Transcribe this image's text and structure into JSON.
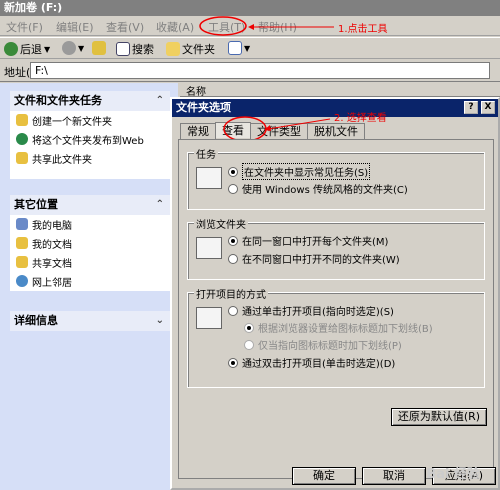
{
  "window": {
    "title": "新加卷 (F:)"
  },
  "menu": {
    "items": [
      "文件(F)",
      "编辑(E)",
      "查看(V)",
      "收藏(A)",
      "工具(T)",
      "帮助(H)"
    ],
    "annotation_1": "1.点击工具"
  },
  "toolbar": {
    "back": "后退",
    "search": "搜索",
    "folders": "文件夹"
  },
  "address": {
    "label": "地址(D)",
    "value": "F:\\"
  },
  "left_panels": {
    "tasks": {
      "title": "文件和文件夹任务",
      "items": [
        "创建一个新文件夹",
        "将这个文件夹发布到Web",
        "共享此文件夹"
      ]
    },
    "other": {
      "title": "其它位置",
      "items": [
        "我的电脑",
        "我的文档",
        "共享文档",
        "网上邻居"
      ]
    },
    "details": {
      "title": "详细信息"
    }
  },
  "listview": {
    "column": "名称"
  },
  "dialog": {
    "title": "文件夹选项",
    "help_btn": "?",
    "close_btn": "X",
    "tabs": [
      "常规",
      "查看",
      "文件类型",
      "脱机文件"
    ],
    "annotation_2": "2. 选择查看",
    "groups": {
      "tasks": {
        "label": "任务",
        "options": [
          "在文件夹中显示常见任务(S)",
          "使用 Windows 传统风格的文件夹(C)"
        ]
      },
      "browse": {
        "label": "浏览文件夹",
        "options": [
          "在同一窗口中打开每个文件夹(M)",
          "在不同窗口中打开不同的文件夹(W)"
        ]
      },
      "open": {
        "label": "打开项目的方式",
        "options": [
          "通过单击打开项目(指向时选定)(S)",
          "根据浏览器设置给图标标题加下划线(B)",
          "仅当指向图标标题时加下划线(P)",
          "通过双击打开项目(单击时选定)(D)"
        ]
      }
    },
    "restore_btn": "还原为默认值(R)",
    "ok_btn": "确定",
    "cancel_btn": "取消",
    "apply_btn": "应用(A)"
  },
  "watermark": "Bai 经验"
}
